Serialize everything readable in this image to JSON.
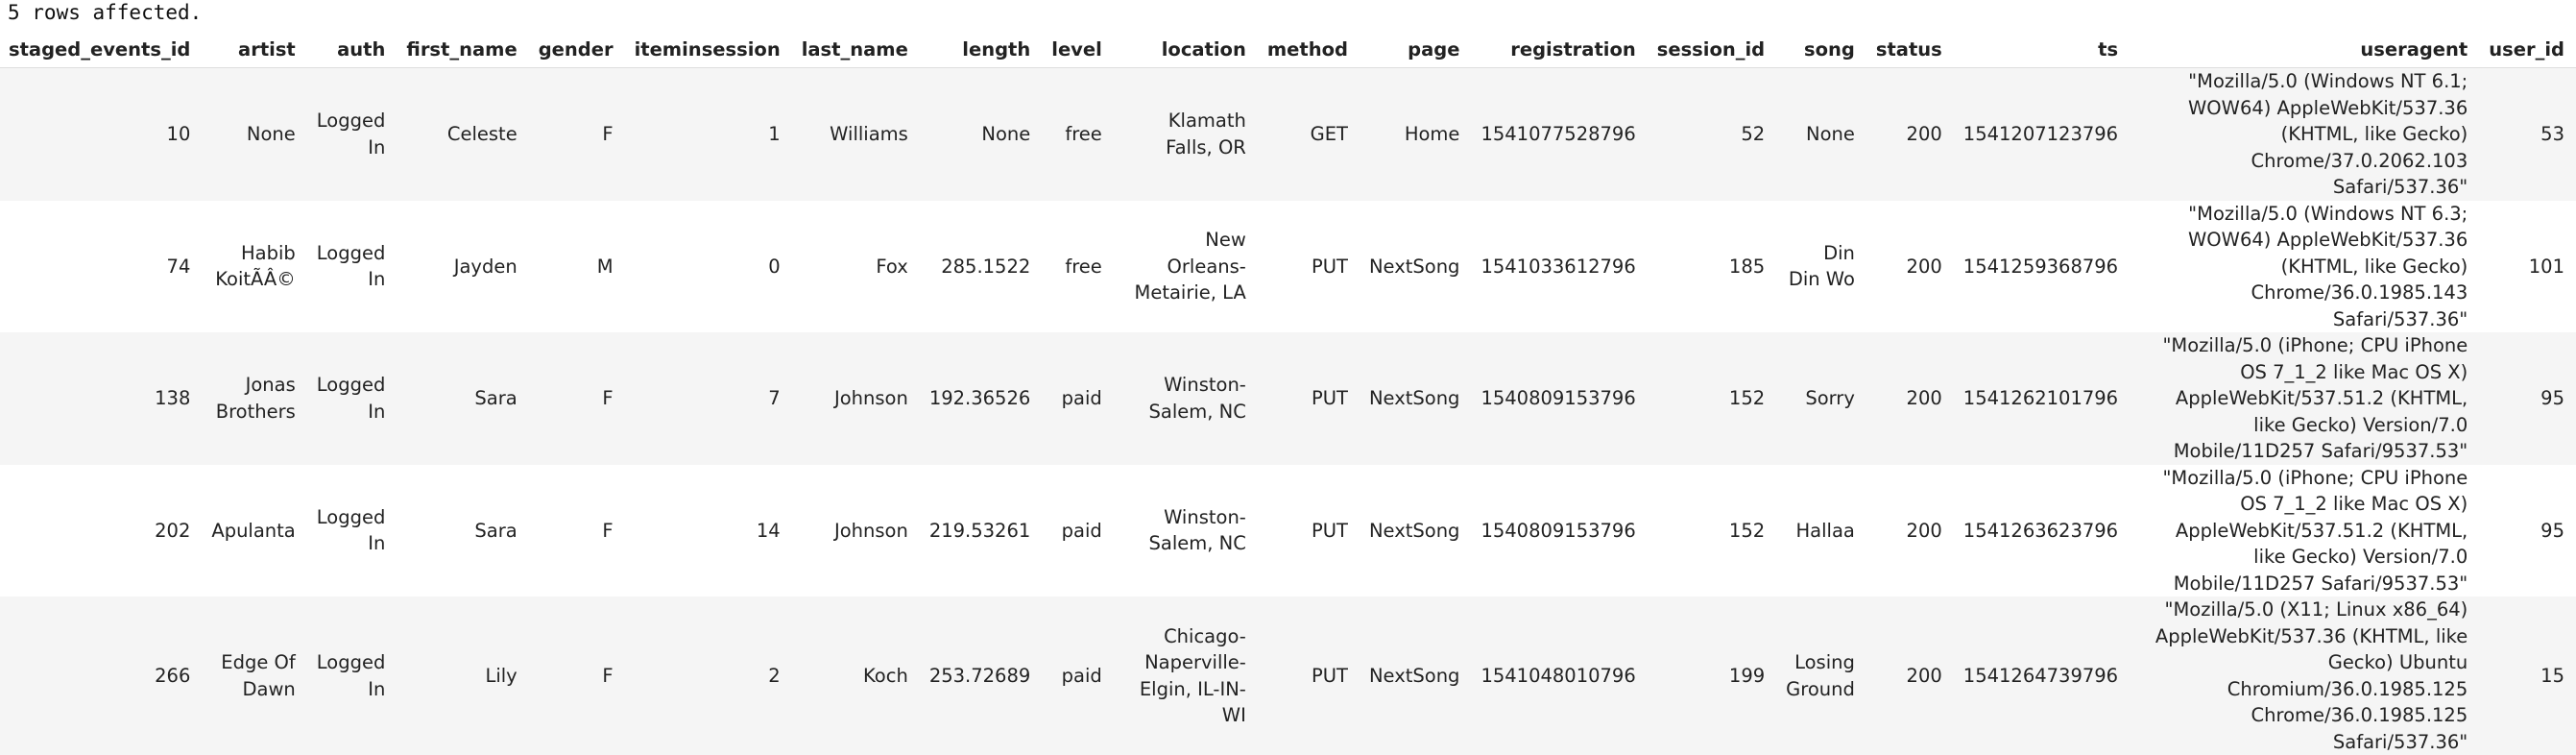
{
  "status_message": "5 rows affected.",
  "table": {
    "columns": [
      "staged_events_id",
      "artist",
      "auth",
      "first_name",
      "gender",
      "iteminsession",
      "last_name",
      "length",
      "level",
      "location",
      "method",
      "page",
      "registration",
      "session_id",
      "song",
      "status",
      "ts",
      "useragent",
      "user_id"
    ],
    "rows": [
      [
        "10",
        "None",
        "Logged In",
        "Celeste",
        "F",
        "1",
        "Williams",
        "None",
        "free",
        "Klamath Falls, OR",
        "GET",
        "Home",
        "1541077528796",
        "52",
        "None",
        "200",
        "1541207123796",
        "\"Mozilla/5.0 (Windows NT 6.1; WOW64) AppleWebKit/537.36 (KHTML, like Gecko) Chrome/37.0.2062.103 Safari/537.36\"",
        "53"
      ],
      [
        "74",
        "Habib KoitÃÂ©",
        "Logged In",
        "Jayden",
        "M",
        "0",
        "Fox",
        "285.1522",
        "free",
        "New Orleans-Metairie, LA",
        "PUT",
        "NextSong",
        "1541033612796",
        "185",
        "Din Din Wo",
        "200",
        "1541259368796",
        "\"Mozilla/5.0 (Windows NT 6.3; WOW64) AppleWebKit/537.36 (KHTML, like Gecko) Chrome/36.0.1985.143 Safari/537.36\"",
        "101"
      ],
      [
        "138",
        "Jonas Brothers",
        "Logged In",
        "Sara",
        "F",
        "7",
        "Johnson",
        "192.36526",
        "paid",
        "Winston-Salem, NC",
        "PUT",
        "NextSong",
        "1540809153796",
        "152",
        "Sorry",
        "200",
        "1541262101796",
        "\"Mozilla/5.0 (iPhone; CPU iPhone OS 7_1_2 like Mac OS X) AppleWebKit/537.51.2 (KHTML, like Gecko) Version/7.0 Mobile/11D257 Safari/9537.53\"",
        "95"
      ],
      [
        "202",
        "Apulanta",
        "Logged In",
        "Sara",
        "F",
        "14",
        "Johnson",
        "219.53261",
        "paid",
        "Winston-Salem, NC",
        "PUT",
        "NextSong",
        "1540809153796",
        "152",
        "Hallaa",
        "200",
        "1541263623796",
        "\"Mozilla/5.0 (iPhone; CPU iPhone OS 7_1_2 like Mac OS X) AppleWebKit/537.51.2 (KHTML, like Gecko) Version/7.0 Mobile/11D257 Safari/9537.53\"",
        "95"
      ],
      [
        "266",
        "Edge Of Dawn",
        "Logged In",
        "Lily",
        "F",
        "2",
        "Koch",
        "253.72689",
        "paid",
        "Chicago-Naperville-Elgin, IL-IN-WI",
        "PUT",
        "NextSong",
        "1541048010796",
        "199",
        "Losing Ground",
        "200",
        "1541264739796",
        "\"Mozilla/5.0 (X11; Linux x86_64) AppleWebKit/537.36 (KHTML, like Gecko) Ubuntu Chromium/36.0.1985.125 Chrome/36.0.1985.125 Safari/537.36\"",
        "15"
      ]
    ]
  }
}
